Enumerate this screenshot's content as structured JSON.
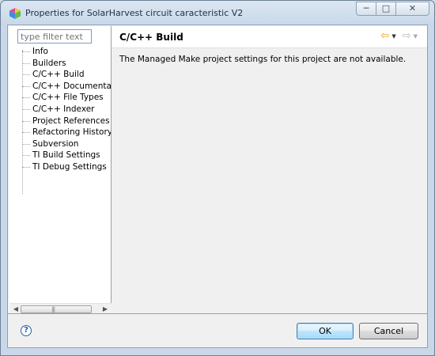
{
  "window": {
    "title": "Properties for SolarHarvest circuit caracteristic V2",
    "controls": {
      "minimize": "─",
      "maximize": "□",
      "close": "✕"
    }
  },
  "sidebar": {
    "filter_placeholder": "type filter text",
    "items": [
      {
        "label": "Info"
      },
      {
        "label": "Builders"
      },
      {
        "label": "C/C++ Build",
        "selected": true
      },
      {
        "label": "C/C++ Documentation"
      },
      {
        "label": "C/C++ File Types"
      },
      {
        "label": "C/C++ Indexer"
      },
      {
        "label": "Project References"
      },
      {
        "label": "Refactoring History"
      },
      {
        "label": "Subversion"
      },
      {
        "label": "TI Build Settings"
      },
      {
        "label": "TI Debug Settings"
      }
    ],
    "scrollbar": {
      "left_arrow": "◀",
      "right_arrow": "▶",
      "grip": "|||"
    }
  },
  "page": {
    "title": "C/C++ Build",
    "message": "The Managed Make project settings for this project are not available.",
    "nav": {
      "back_icon": "⇦",
      "forward_icon": "⇨",
      "dropdown_icon": "▼"
    }
  },
  "footer": {
    "help_glyph": "?",
    "ok_label": "OK",
    "cancel_label": "Cancel"
  },
  "colors": {
    "accent_back_arrow": "#e8a21a",
    "ok_button_border": "#3c7fb1"
  },
  "icons": {
    "app": "eclipse-cube-icon",
    "help": "help-icon"
  }
}
